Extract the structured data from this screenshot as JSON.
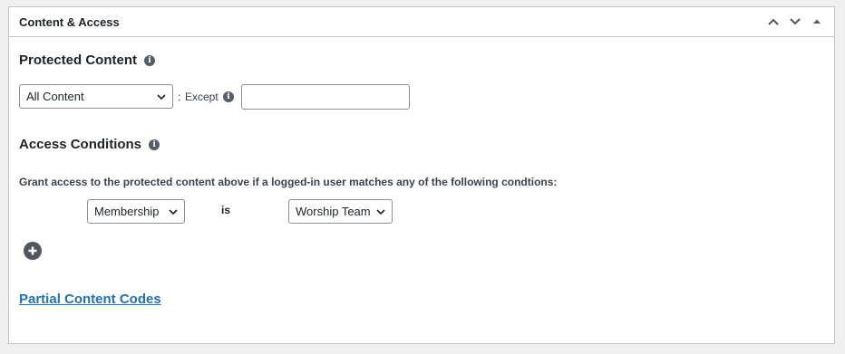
{
  "panel": {
    "title": "Content & Access",
    "icons": [
      "chevron-up-icon",
      "chevron-down-icon",
      "triangle-up-icon"
    ]
  },
  "protected_content": {
    "heading": "Protected Content",
    "select_value": "All Content",
    "separator": ":",
    "except_label": "Except",
    "except_value": ""
  },
  "access_conditions": {
    "heading": "Access Conditions",
    "description": "Grant access to the protected content above if a logged-in user matches any of the following condtions:",
    "condition": {
      "type_value": "Membership",
      "operator": "is",
      "value": "Worship Team"
    }
  },
  "partial_link": "Partial Content Codes",
  "colors": {
    "link": "#2271b1",
    "border": "#c3c4c7",
    "icon": "#555d66"
  }
}
